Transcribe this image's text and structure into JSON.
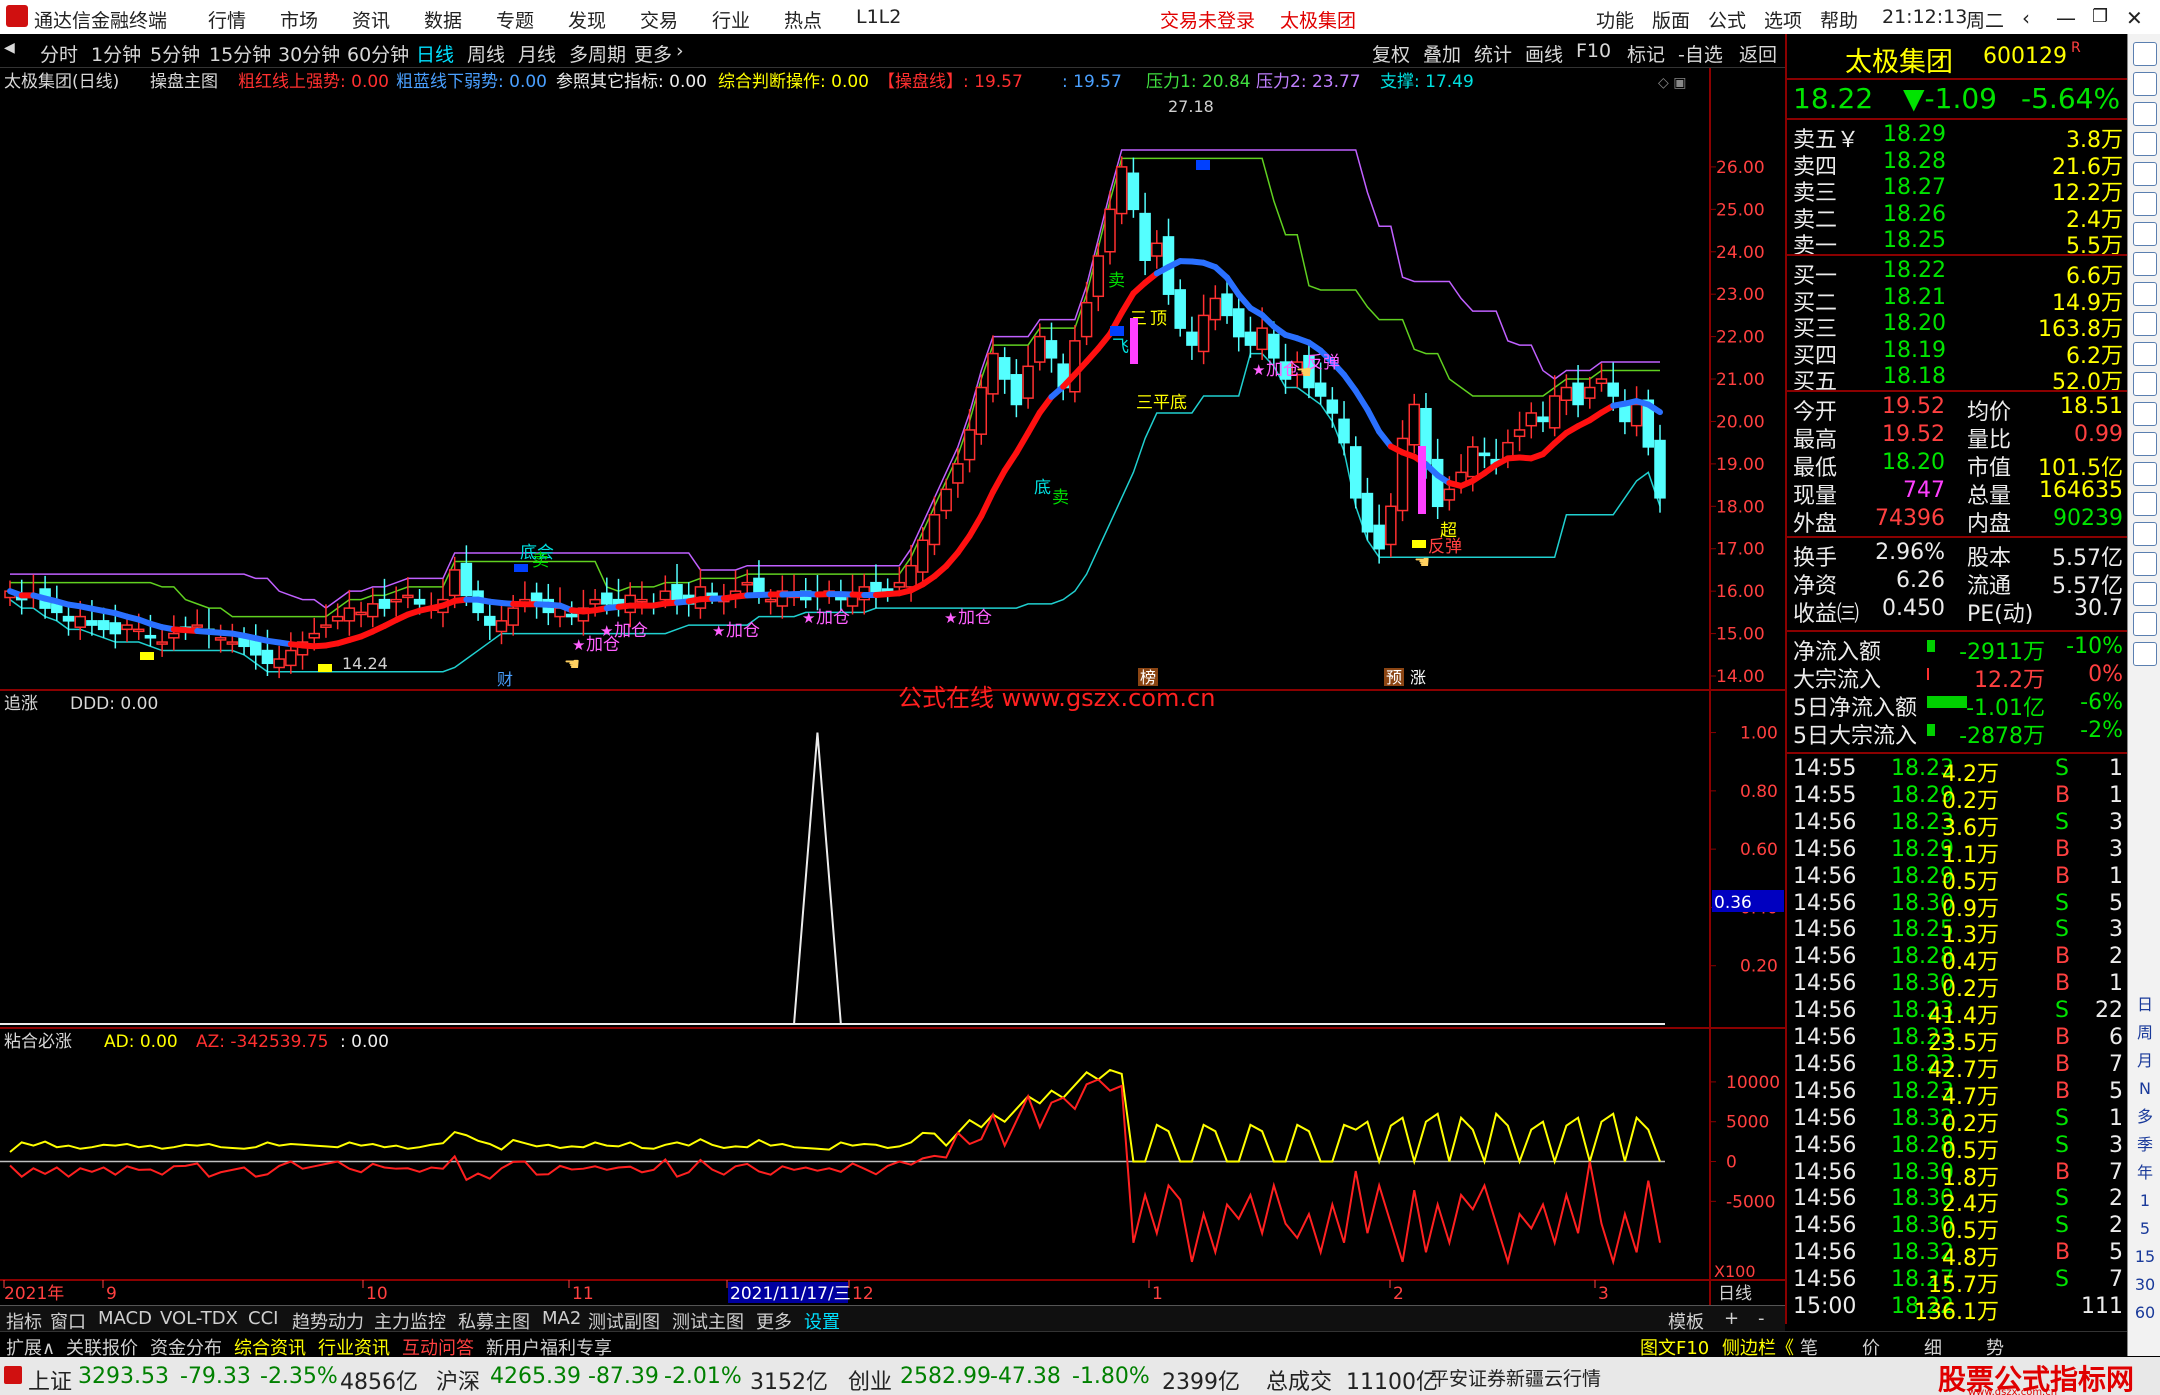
{
  "app": {
    "title": "通达信金融终端",
    "menus": [
      "行情",
      "市场",
      "资讯",
      "数据",
      "专题",
      "发现",
      "交易",
      "行业",
      "热点",
      "L1L2"
    ],
    "trade_status": "交易未登录",
    "stock_menu": "太极集团",
    "right_menus": [
      "功能",
      "版面",
      "公式",
      "选项",
      "帮助"
    ],
    "time": "21:12:13",
    "weekday": "周二"
  },
  "timeframes": [
    "分时",
    "1分钟",
    "5分钟",
    "15分钟",
    "30分钟",
    "60分钟",
    "日线",
    "周线",
    "月线",
    "多周期",
    "更多"
  ],
  "chart_tools": [
    "复权",
    "叠加",
    "统计",
    "画线",
    "F10",
    "标记",
    "-自选",
    "返回"
  ],
  "main_chart": {
    "title": "太极集团(日线)",
    "indicator": "操盘主图",
    "l1": "粗红线上强势: 0.00",
    "l2": "粗蓝线下弱势: 0.00",
    "l3": "参照其它指标: 0.00",
    "l4": "综合判断操作: 0.00",
    "l5": "【操盘线】: 19.57",
    "l6": ": 19.57",
    "l7": "压力1: 20.84",
    "l8": "压力2: 23.77",
    "l9": "支撑: 17.49",
    "price_axis": [
      "26.00",
      "25.00",
      "24.00",
      "23.00",
      "22.00",
      "21.00",
      "20.00",
      "19.00",
      "18.00",
      "17.00",
      "16.00",
      "15.00",
      "14.00"
    ],
    "peak": "27.18",
    "low": "14.24",
    "watermark": "公式在线  www.gszx.com.cn",
    "events": [
      "财",
      "榜",
      "预",
      "涨"
    ],
    "signals": {
      "sell": "卖",
      "sell2": "卖",
      "sell3": "卖",
      "s_top": "顶",
      "s_ac": "底会",
      "add": "加仓",
      "s_sanping": "三平底",
      "s_bottom": "底",
      "fantan": "反弹",
      "f2": "飞",
      "chao": "超",
      "san": "三"
    }
  },
  "chart_data": [
    {
      "type": "candlestick",
      "title": "太极集团(日线)",
      "y_range": [
        14.0,
        27.2
      ],
      "x_labels": [
        "2021年",
        "9",
        "10",
        "11",
        "2021/11/17/三",
        "12",
        "1",
        "2",
        "3"
      ],
      "close": [
        16.0,
        15.8,
        15.9,
        15.6,
        15.5,
        15.3,
        15.4,
        15.2,
        15.1,
        15.0,
        15.2,
        15.1,
        14.9,
        14.8,
        15.0,
        15.1,
        15.2,
        15.0,
        14.9,
        14.8,
        14.7,
        14.5,
        14.3,
        14.4,
        14.6,
        14.8,
        15.0,
        15.2,
        15.4,
        15.6,
        15.5,
        15.7,
        15.6,
        15.8,
        15.9,
        15.7,
        15.6,
        15.8,
        16.5,
        15.9,
        15.5,
        15.2,
        15.3,
        15.6,
        15.8,
        15.7,
        15.5,
        15.6,
        15.4,
        15.6,
        15.8,
        15.7,
        15.6,
        15.9,
        15.8,
        15.7,
        16.0,
        15.8,
        15.7,
        16.1,
        15.9,
        15.8,
        16.0,
        16.2,
        15.9,
        15.8,
        16.0,
        15.9,
        15.8,
        15.9,
        16.0,
        15.8,
        15.9,
        16.1,
        15.9,
        16.0,
        16.2,
        16.6,
        17.2,
        17.8,
        18.4,
        19.0,
        19.8,
        20.8,
        21.6,
        21.0,
        20.4,
        21.3,
        22.0,
        21.5,
        20.8,
        21.9,
        22.8,
        23.9,
        25.0,
        26.0,
        25.0,
        23.8,
        24.2,
        23.0,
        22.2,
        21.8,
        22.5,
        22.9,
        22.5,
        22.0,
        21.8,
        22.2,
        21.5,
        21.0,
        21.4,
        20.8,
        20.6,
        20.2,
        19.5,
        18.2,
        17.4,
        17.0,
        18.0,
        19.6,
        20.4,
        19.0,
        18.0,
        18.4,
        18.8,
        19.4,
        19.2,
        19.0,
        19.5,
        19.8,
        20.2,
        20.0,
        20.6,
        20.8,
        20.4,
        20.8,
        21.0,
        20.6,
        20.0,
        20.4,
        19.4,
        18.2
      ]
    },
    {
      "type": "line",
      "title": "追涨",
      "series": [
        {
          "name": "DDD",
          "value_text": "DDD: 0.00"
        }
      ],
      "y_axis": [
        "1.00",
        "0.80",
        "0.60",
        "0.40",
        "0.20"
      ],
      "cursor_value": "0.36",
      "y_range": [
        0,
        1.05
      ],
      "spike_index": 69
    },
    {
      "type": "line",
      "title": "粘合必涨",
      "series": [
        {
          "name": "AD",
          "value_text": "AD: 0.00"
        },
        {
          "name": "AZ",
          "value_text": "AZ: -342539.75"
        },
        {
          "name": "",
          "value_text": ": 0.00"
        }
      ],
      "y_axis": [
        "10000",
        "5000",
        "0",
        "-5000"
      ],
      "y_range": [
        -14000,
        13000
      ],
      "scale": "X100"
    }
  ],
  "quote": {
    "name": "太极集团",
    "code": "600129",
    "r": "R",
    "price": "18.22",
    "change": "▼-1.09",
    "pct": "-5.64%",
    "asks": [
      [
        "卖五￥",
        "18.29",
        "3.8万"
      ],
      [
        "卖四",
        "18.28",
        "21.6万"
      ],
      [
        "卖三",
        "18.27",
        "12.2万"
      ],
      [
        "卖二",
        "18.26",
        "2.4万"
      ],
      [
        "卖一",
        "18.25",
        "5.5万"
      ]
    ],
    "bids": [
      [
        "买一",
        "18.22",
        "6.6万"
      ],
      [
        "买二",
        "18.21",
        "14.9万"
      ],
      [
        "买三",
        "18.20",
        "163.8万"
      ],
      [
        "买四",
        "18.19",
        "6.2万"
      ],
      [
        "买五",
        "18.18",
        "52.0万"
      ]
    ],
    "stats": [
      [
        "今开",
        "19.52",
        "均价",
        "18.51"
      ],
      [
        "最高",
        "19.52",
        "量比",
        "0.99"
      ],
      [
        "最低",
        "18.20",
        "市值",
        "101.5亿"
      ],
      [
        "现量",
        "747",
        "总量",
        "164635"
      ],
      [
        "外盘",
        "74396",
        "内盘",
        "90239"
      ]
    ],
    "stats2": [
      [
        "换手",
        "2.96%",
        "股本",
        "5.57亿"
      ],
      [
        "净资",
        "6.26",
        "流通",
        "5.57亿"
      ],
      [
        "收益㈢",
        "0.450",
        "PE(动)",
        "30.7"
      ]
    ],
    "flows": [
      [
        "净流入额",
        "-2911万",
        "-10%"
      ],
      [
        "大宗流入",
        "12.2万",
        "0%"
      ],
      [
        "5日净流入额",
        "-1.01亿",
        "-6%"
      ],
      [
        "5日大宗流入",
        "-2878万",
        "-2%"
      ]
    ],
    "ticks": [
      [
        "14:55",
        "18.23",
        "4.2万",
        "S",
        "1"
      ],
      [
        "14:55",
        "18.29",
        "0.2万",
        "B",
        "1"
      ],
      [
        "14:56",
        "18.23",
        "3.6万",
        "S",
        "3"
      ],
      [
        "14:56",
        "18.29",
        "1.1万",
        "B",
        "3"
      ],
      [
        "14:56",
        "18.29",
        "0.5万",
        "B",
        "1"
      ],
      [
        "14:56",
        "18.30",
        "0.9万",
        "S",
        "5"
      ],
      [
        "14:56",
        "18.25",
        "1.3万",
        "S",
        "3"
      ],
      [
        "14:56",
        "18.28",
        "0.4万",
        "B",
        "2"
      ],
      [
        "14:56",
        "18.30",
        "0.2万",
        "B",
        "1"
      ],
      [
        "14:56",
        "18.23",
        "41.4万",
        "S",
        "22"
      ],
      [
        "14:56",
        "18.23",
        "23.5万",
        "B",
        "6"
      ],
      [
        "14:56",
        "18.23",
        "42.7万",
        "B",
        "7"
      ],
      [
        "14:56",
        "18.23",
        "4.7万",
        "B",
        "5"
      ],
      [
        "14:56",
        "18.32",
        "0.2万",
        "S",
        "1"
      ],
      [
        "14:56",
        "18.28",
        "0.5万",
        "S",
        "3"
      ],
      [
        "14:56",
        "18.30",
        "1.8万",
        "B",
        "7"
      ],
      [
        "14:56",
        "18.30",
        "2.4万",
        "S",
        "2"
      ],
      [
        "14:56",
        "18.30",
        "0.5万",
        "S",
        "2"
      ],
      [
        "14:56",
        "18.32",
        "4.8万",
        "B",
        "5"
      ],
      [
        "14:56",
        "18.27",
        "15.7万",
        "S",
        "7"
      ],
      [
        "15:00",
        "18.22",
        "136.1万",
        "",
        "111"
      ]
    ]
  },
  "tabs": [
    "指标",
    "窗口",
    "MACD",
    "VOL-TDX",
    "CCI",
    "趋势动力",
    "主力监控",
    "私募主图",
    "MA2",
    "测试副图",
    "测试主图",
    "更多",
    "设置"
  ],
  "tabs_right": [
    "模板",
    "+",
    "-"
  ],
  "tabs2": [
    "扩展∧",
    "关联报价",
    "资金分布",
    "综合资讯",
    "行业资讯",
    "互动问答",
    "新用户福利专享"
  ],
  "tabs2_right": [
    "图文F10",
    "侧边栏《",
    "笔",
    "价",
    "细",
    "势"
  ],
  "rightbar": [
    "日",
    "周",
    "月",
    "N",
    "多",
    "季",
    "年",
    "1",
    "5",
    "15",
    "30",
    "60"
  ],
  "status": {
    "sh_name": "上证",
    "sh": "3293.53",
    "sh_chg": "-79.33",
    "sh_pct": "-2.35%",
    "sh_amt": "4856亿",
    "sz_name": "沪深",
    "sz": "4265.39",
    "sz_chg": "-87.39",
    "sz_pct": "-2.01%",
    "sz_amt": "3152亿",
    "cy_name": "创业",
    "cy": "2582.99",
    "cy_chg": "-47.38",
    "cy_pct": "-1.80%",
    "cy_amt": "2399亿",
    "total": "总成交",
    "total_v": "11100亿",
    "broker": "平安证券新疆云行情",
    "site": "股票公式指标网",
    "site_url": "www.gszx.com.cn"
  }
}
